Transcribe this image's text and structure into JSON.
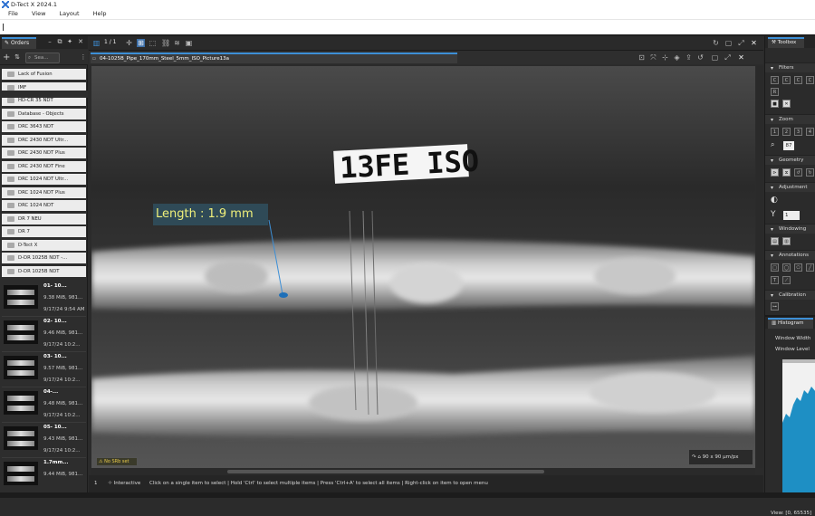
{
  "app": {
    "title": "D-Tect X 2024.1"
  },
  "menu": [
    "File",
    "View",
    "Layout",
    "Help"
  ],
  "left_panel": {
    "tab_label": "Orders",
    "search_placeholder": "Sea...",
    "folders": [
      "Lack of Fusion",
      "IMF",
      "HD-CR 35 NDT",
      "Database - Objects",
      "DRC 3643 NDT",
      "DRC 2430 NDT Ultr...",
      "DRC 2430 NDT Plus",
      "DRC 2430 NDT Fine",
      "DRC 1024 NDT Ultr...",
      "DRC 1024 NDT Plus",
      "DRC 1024 NDT",
      "DR 7 NEU",
      "DR 7",
      "D-Tect X",
      "D-DR 1025B NDT -...",
      "D-DR 1025B NDT"
    ],
    "items": [
      {
        "title": "01- 10...",
        "size": "9.38 MiB, 981...",
        "date": "9/17/24 9:54 AM"
      },
      {
        "title": "02- 10...",
        "size": "9.46 MiB, 981...",
        "date": "9/17/24 10:2..."
      },
      {
        "title": "03- 10...",
        "size": "9.57 MiB, 981...",
        "date": "9/17/24 10:2..."
      },
      {
        "title": "04-...",
        "size": "9.48 MiB, 981...",
        "date": "9/17/24 10:2..."
      },
      {
        "title": "05- 10...",
        "size": "9.43 MiB, 981...",
        "date": "9/17/24 10:2..."
      },
      {
        "title": "1.7mm...",
        "size": "9.44 MiB, 981...",
        "date": ""
      }
    ]
  },
  "center": {
    "page_indicator": "1 / 1",
    "tab_title": "04-1025B_Pipe_170mm_Steel_5mm_ISO_Picture13a",
    "measurement_label": "Length : 1.9 mm",
    "image_marking": "13FE ISO",
    "srb_badge": "No SRb set",
    "pixel_size": "90 x 90 µm/px"
  },
  "status": {
    "page": "1",
    "mode": "Interactive",
    "hint": "Click on a single item to select | Hold 'Ctrl' to select multiple items | Press 'Ctrl+A' to select all items | Right-click on item to open menu"
  },
  "right_panel": {
    "toolbox_label": "Toolbox",
    "sections": [
      "Filters",
      "Zoom",
      "Geometry",
      "Adjustment",
      "Windowing",
      "Annotations",
      "Calibration"
    ],
    "zoom_value": "87",
    "adjust_value": "1",
    "adjust_label": "Y",
    "histogram_label": "Histogram",
    "window_width_label": "Window Width",
    "window_level_label": "Window Level",
    "view_range": "View: [0, 65535]"
  },
  "colors": {
    "accent": "#3d8fd6",
    "label_bg": "#2f4a57",
    "label_text": "#f0f07a",
    "histogram": "#1e8fc4"
  }
}
